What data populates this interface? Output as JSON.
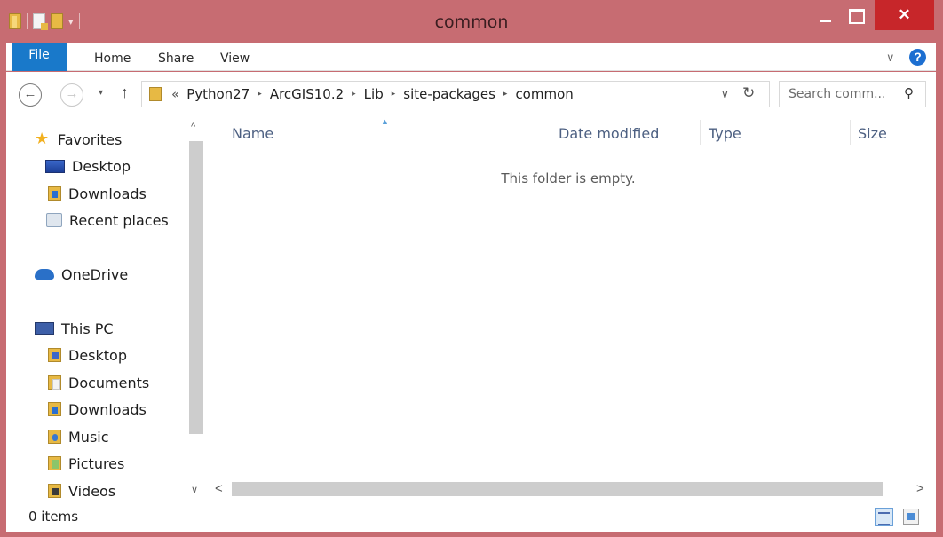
{
  "window": {
    "title": "common",
    "close_glyph": "✕"
  },
  "ribbon": {
    "tabs": [
      "File",
      "Home",
      "Share",
      "View"
    ],
    "expand_glyph": "∨",
    "help_glyph": "?"
  },
  "navigation": {
    "back_glyph": "←",
    "forward_glyph": "→",
    "recent_glyph": "▾",
    "up_glyph": "↑",
    "overflow_glyph": "«",
    "separator_glyph": "▸",
    "breadcrumbs": [
      "Python27",
      "ArcGIS10.2",
      "Lib",
      "site-packages",
      "common"
    ],
    "dropdown_glyph": "∨",
    "refresh_glyph": "↻"
  },
  "search": {
    "placeholder": "Search comm...",
    "icon_glyph": "⚲"
  },
  "sidebar": {
    "favorites": {
      "label": "Favorites",
      "items": [
        "Desktop",
        "Downloads",
        "Recent places"
      ]
    },
    "onedrive": {
      "label": "OneDrive"
    },
    "this_pc": {
      "label": "This PC",
      "items": [
        "Desktop",
        "Documents",
        "Downloads",
        "Music",
        "Pictures",
        "Videos"
      ]
    },
    "star_glyph": "★",
    "scroll_up_glyph": "^",
    "scroll_down_glyph": "∨"
  },
  "columns": {
    "name": "Name",
    "date_modified": "Date modified",
    "type": "Type",
    "size": "Size",
    "sort_glyph": "▲"
  },
  "content": {
    "empty_message": "This folder is empty."
  },
  "hscroll": {
    "left_glyph": "<",
    "right_glyph": ">"
  },
  "status": {
    "item_count": "0 items"
  },
  "colors": {
    "frame": "#c76c72",
    "file_tab": "#1979ca",
    "close_button": "#c7262a",
    "folder": "#e7b944",
    "column_header": "#4d6082"
  },
  "icons": {
    "favorites": "star-icon",
    "desktop": "desktop-icon",
    "downloads": "downloads-folder-icon",
    "recent": "recent-places-icon",
    "onedrive": "cloud-icon",
    "this_pc": "computer-icon",
    "documents": "documents-folder-icon",
    "music": "music-folder-icon",
    "pictures": "pictures-folder-icon",
    "videos": "videos-folder-icon"
  }
}
